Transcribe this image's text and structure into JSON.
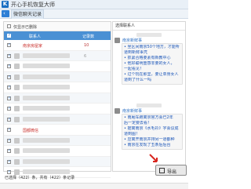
{
  "app": {
    "title": "开心手机恢复大师",
    "logo_letter": "K"
  },
  "tabs": {
    "back_glyph": "‹",
    "active_label": "微信聊天记录"
  },
  "left": {
    "toolbar_label": "仅显示已删除",
    "col_contact": "联系人",
    "col_count": "记录数",
    "rows": [
      {
        "checked": true,
        "name": "南京房屋家",
        "name_visible": true,
        "count": "10",
        "count_red": true
      },
      {
        "checked": true,
        "name": "",
        "name_visible": false,
        "count": "6",
        "count_red": false
      },
      {
        "checked": true,
        "name": "",
        "name_visible": false,
        "count": "",
        "count_red": false
      },
      {
        "checked": true,
        "name": "",
        "name_visible": false,
        "count": "",
        "count_red": false
      },
      {
        "checked": true,
        "name": "",
        "name_visible": false,
        "count": "",
        "count_red": false
      },
      {
        "checked": true,
        "name": "",
        "name_visible": false,
        "count": "",
        "count_red": false
      },
      {
        "checked": true,
        "name": "",
        "name_visible": false,
        "count": "",
        "count_red": false
      },
      {
        "checked": true,
        "name": "",
        "name_visible": false,
        "count": "",
        "count_red": false
      },
      {
        "checked": true,
        "name": "国都微信",
        "name_visible": true,
        "count": "",
        "count_red": false
      },
      {
        "checked": true,
        "name": "",
        "name_visible": false,
        "count": "",
        "count_red": false
      },
      {
        "checked": true,
        "name": "",
        "name_visible": false,
        "count": "",
        "count_red": false
      },
      {
        "checked": true,
        "name": "",
        "name_visible": false,
        "count": "",
        "count_red": false
      },
      {
        "checked": true,
        "name": "",
        "name_visible": false,
        "count": "",
        "count_red": false
      }
    ],
    "footer": "已选择（422）条，共有（422）条记录"
  },
  "right": {
    "header": "选择联系人",
    "messages": [
      {
        "sender": "南京新鲜事",
        "lines": [
          "• 坐区间南京50个地方，才能听",
          "道到新鲜事凭",
          "• 抓紧合格要素有新教中心",
          "• 他好聪明重感非要的女人，",
          "  一起看见！",
          "• 过个玩在那里，要让单身女人",
          "道到了什么一吗"
        ]
      },
      {
        "sender": "南京新鲜事",
        "lines": [
          "• 南厢车跑离京官方会已2年",
          "   后一定要去看！",
          "• 据离南京《水毛衫》字会议成",
          "道到图！",
          "• 应离开南京并排另一道都种",
          "• 南京在发现了五条后后台"
        ]
      }
    ]
  },
  "export_label": "导出",
  "colors": {
    "accent": "#4a90d4",
    "link": "#1a55b8",
    "warn": "#c9302c"
  }
}
